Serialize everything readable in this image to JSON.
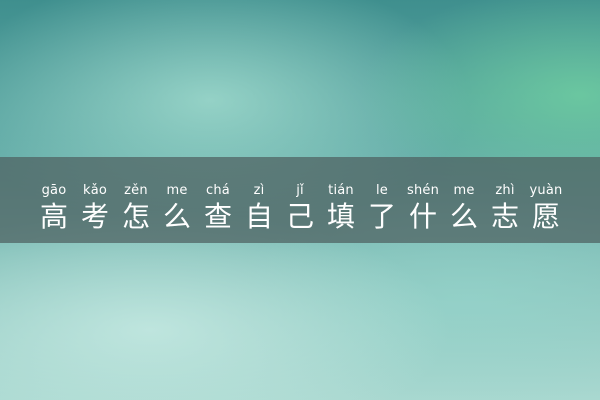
{
  "title": {
    "chars": [
      {
        "pinyin": "gāo",
        "hanzi": "高"
      },
      {
        "pinyin": "kǎo",
        "hanzi": "考"
      },
      {
        "pinyin": "zěn",
        "hanzi": "怎"
      },
      {
        "pinyin": "me",
        "hanzi": "么"
      },
      {
        "pinyin": "chá",
        "hanzi": "查"
      },
      {
        "pinyin": "zì",
        "hanzi": "自"
      },
      {
        "pinyin": "jǐ",
        "hanzi": "己"
      },
      {
        "pinyin": "tián",
        "hanzi": "填"
      },
      {
        "pinyin": "le",
        "hanzi": "了"
      },
      {
        "pinyin": "shén",
        "hanzi": "什"
      },
      {
        "pinyin": "me",
        "hanzi": "么"
      },
      {
        "pinyin": "zhì",
        "hanzi": "志"
      },
      {
        "pinyin": "yuàn",
        "hanzi": "愿"
      }
    ]
  }
}
